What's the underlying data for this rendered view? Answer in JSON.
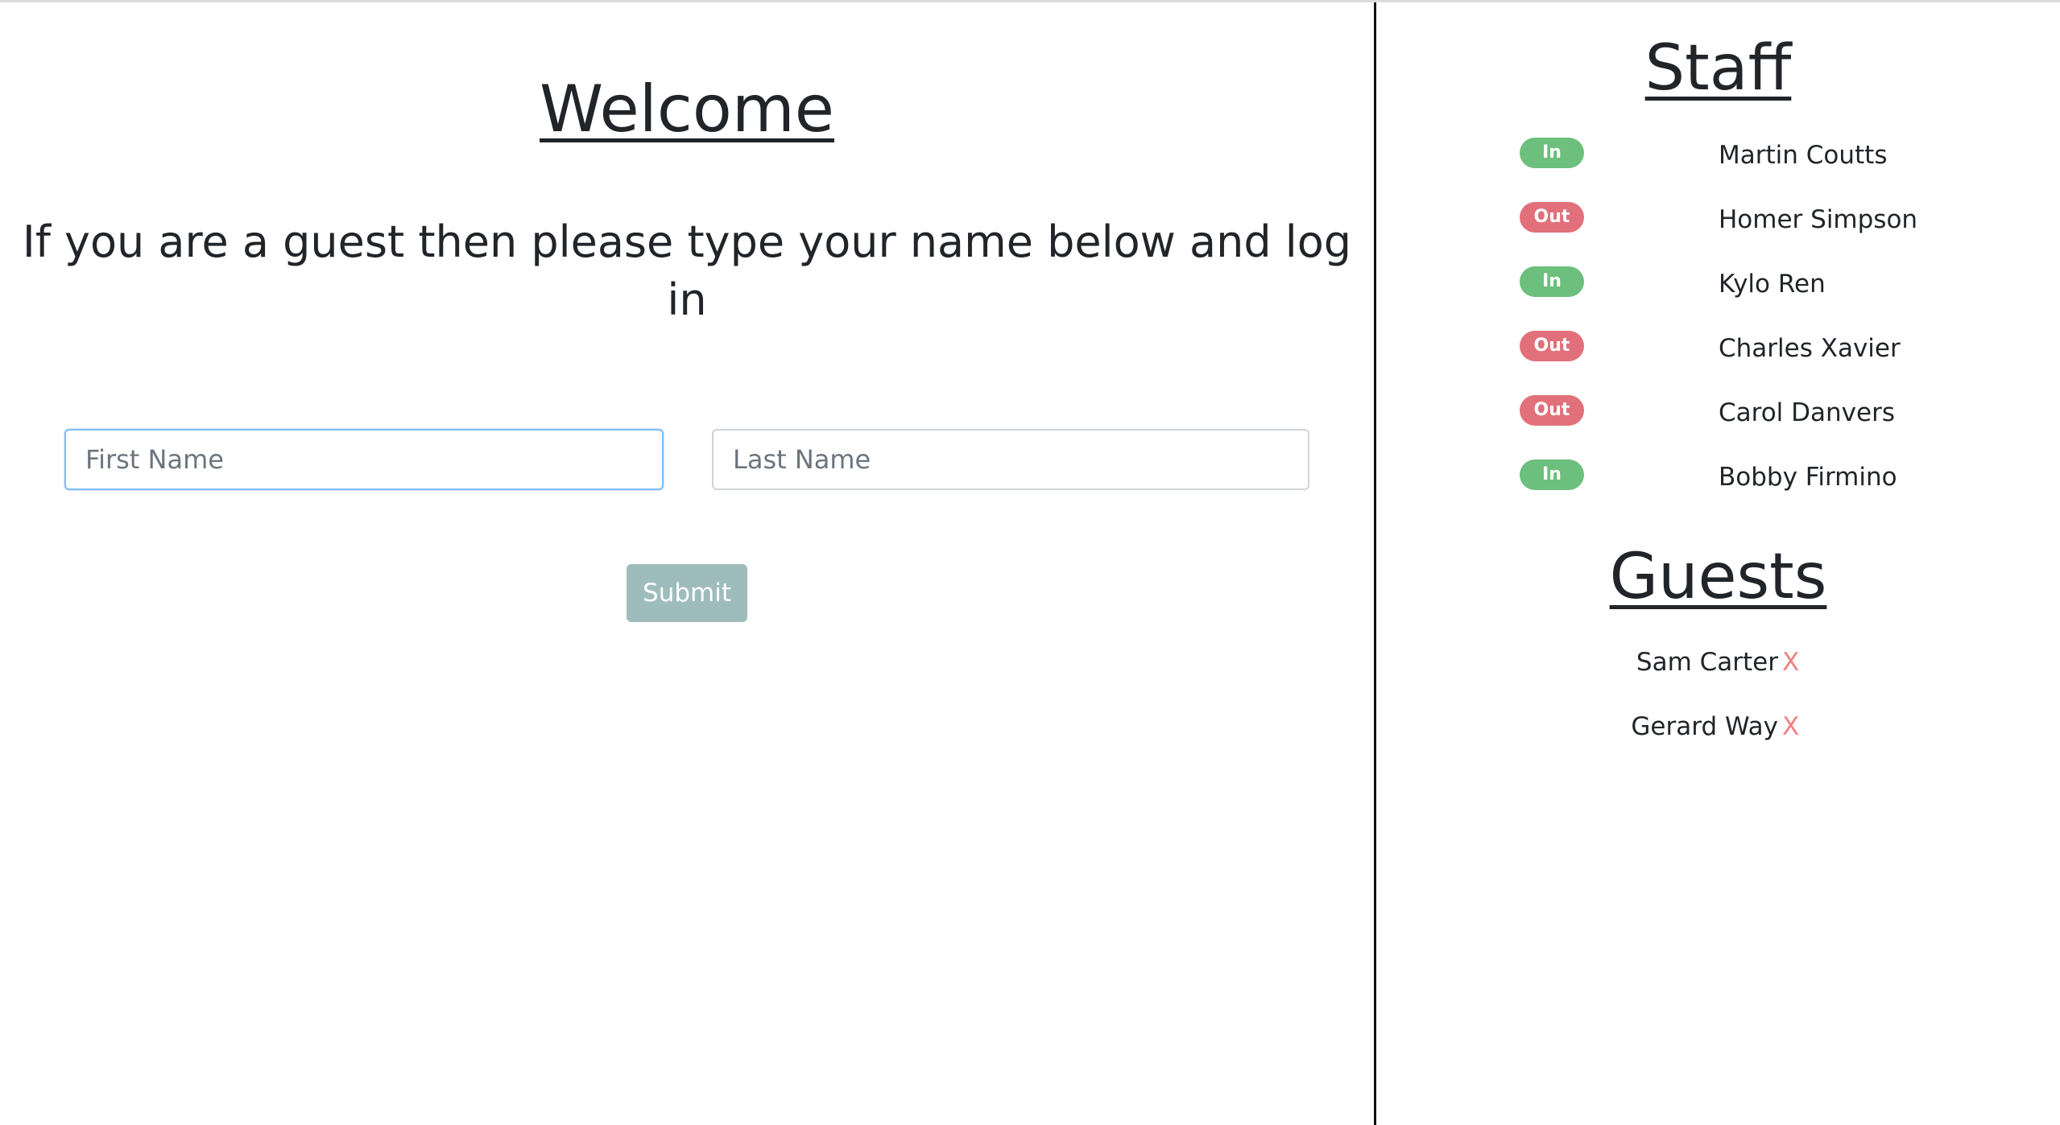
{
  "welcome": {
    "title": "Welcome",
    "instructions": "If you are a guest then please type your name below and log in"
  },
  "form": {
    "first_name_placeholder": "First Name",
    "last_name_placeholder": "Last Name",
    "first_name_value": "",
    "last_name_value": "",
    "submit_label": "Submit"
  },
  "staff": {
    "title": "Staff",
    "members": [
      {
        "status": "In",
        "name": "Martin Coutts"
      },
      {
        "status": "Out",
        "name": "Homer Simpson"
      },
      {
        "status": "In",
        "name": "Kylo Ren"
      },
      {
        "status": "Out",
        "name": "Charles Xavier"
      },
      {
        "status": "Out",
        "name": "Carol Danvers"
      },
      {
        "status": "In",
        "name": "Bobby Firmino"
      }
    ]
  },
  "guests": {
    "title": "Guests",
    "remove_label": "X",
    "list": [
      {
        "name": "Sam Carter"
      },
      {
        "name": "Gerard Way"
      }
    ]
  },
  "colors": {
    "status_in": "#6cbf7c",
    "status_out": "#e2707a",
    "submit_button": "#9fbcbc",
    "remove_x": "#f08080",
    "input_focus_border": "#80bdff"
  }
}
